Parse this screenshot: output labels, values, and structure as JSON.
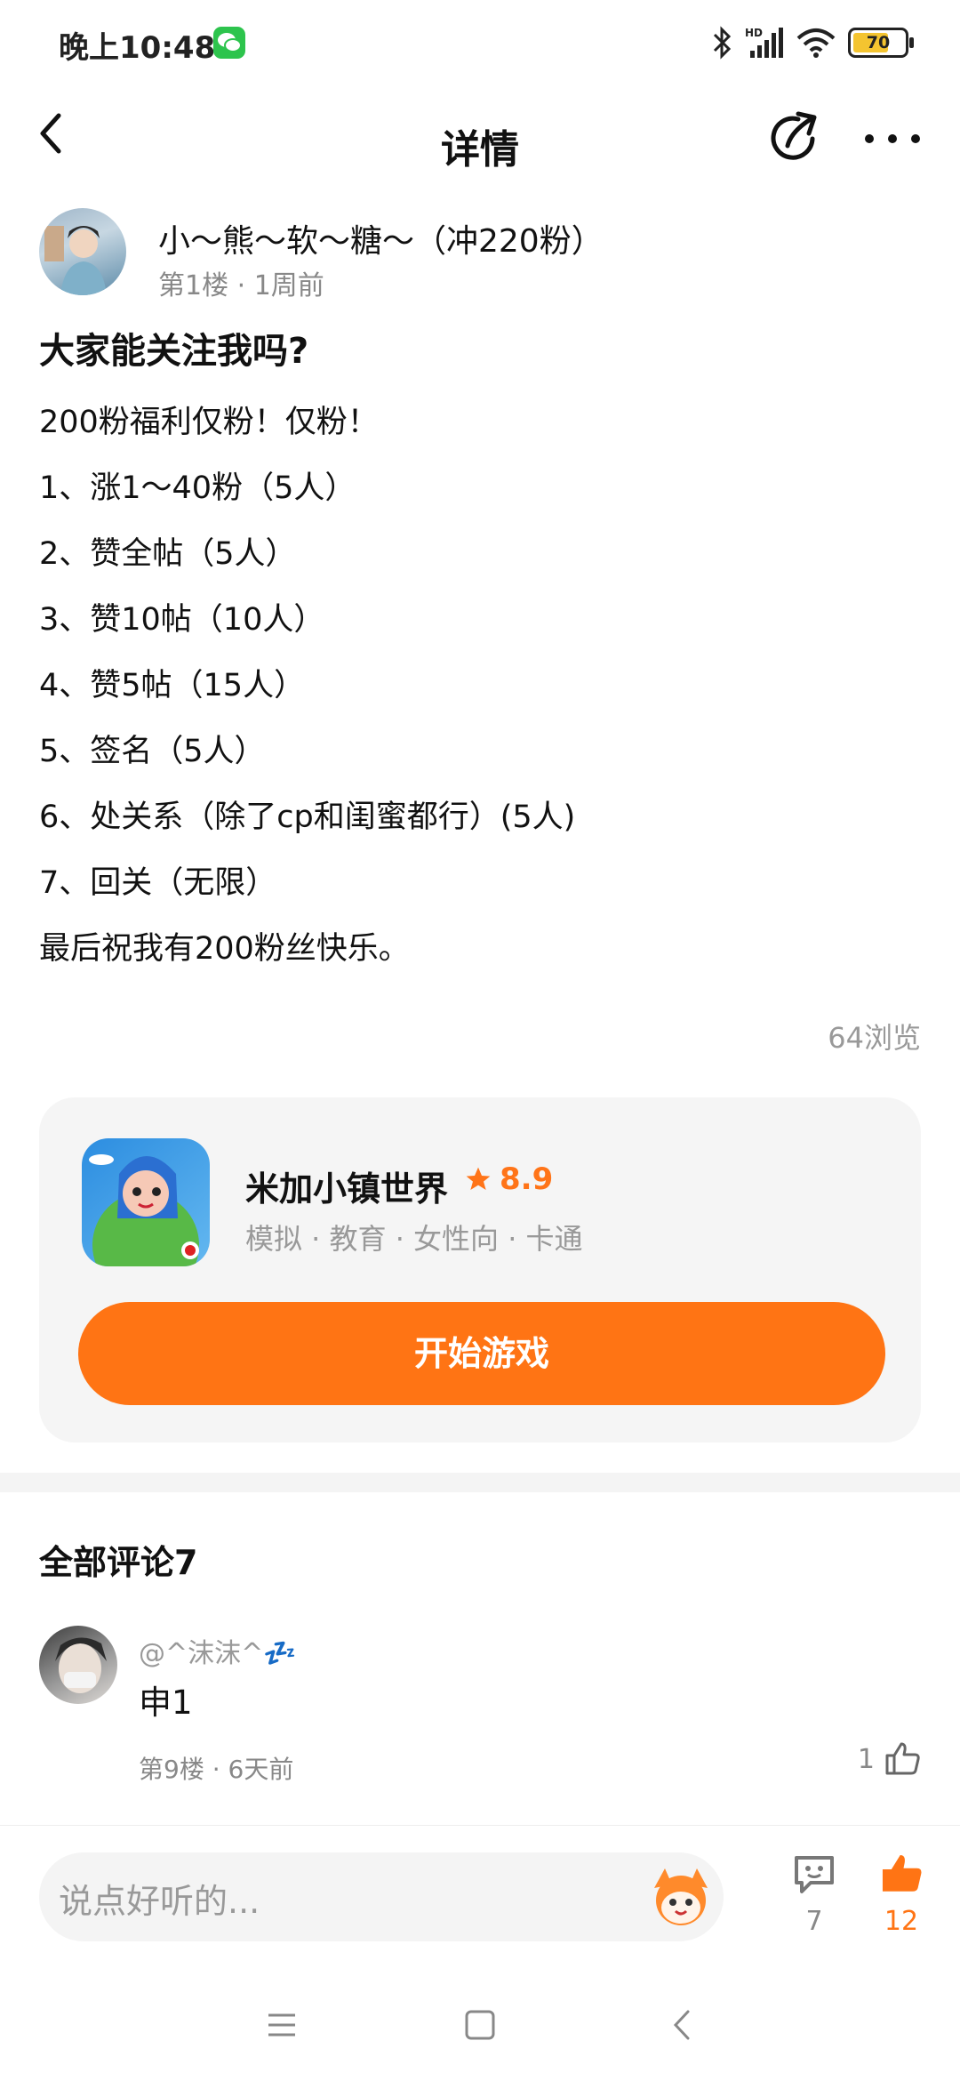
{
  "status_bar": {
    "time": "晚上10:48",
    "battery": "70"
  },
  "nav": {
    "title": "详情"
  },
  "author": {
    "name": "小～熊～软～糖～（冲220粉）",
    "meta": "第1楼 · 1周前"
  },
  "post": {
    "title": "大家能关注我吗?",
    "lines": [
      "200粉福利仅粉！仅粉！",
      "1、涨1～40粉（5人）",
      "2、赞全帖（5人）",
      "3、赞10帖（10人）",
      "4、赞5帖（15人）",
      "5、签名（5人）",
      "6、处关系（除了cp和闺蜜都行）(5人)",
      "7、回关（无限）",
      "最后祝我有200粉丝快乐。"
    ],
    "views": "64浏览"
  },
  "game": {
    "name": "米加小镇世界",
    "rating": "8.9",
    "tags": "模拟 · 教育 · 女性向 · 卡通",
    "play_label": "开始游戏"
  },
  "comments": {
    "title": "全部评论7",
    "items": [
      {
        "user": "@^沫沫^💤",
        "text": "申1",
        "meta": "第9楼 · 6天前",
        "likes": "1"
      }
    ]
  },
  "bottom_bar": {
    "placeholder": "说点好听的...",
    "comment_count": "7",
    "like_count": "12"
  },
  "colors": {
    "accent": "#FF7414",
    "card_bg": "#F5F5F5"
  }
}
